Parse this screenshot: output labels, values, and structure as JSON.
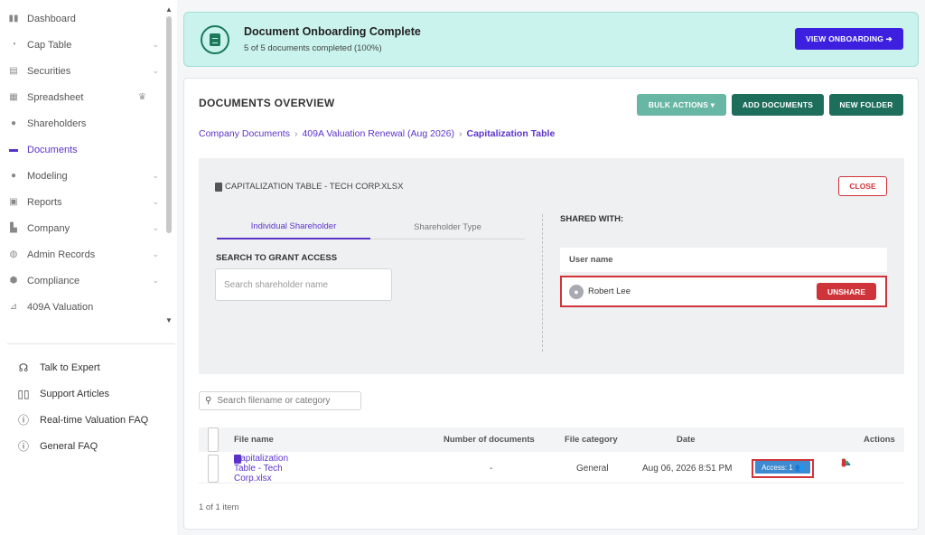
{
  "sidebar": {
    "items": [
      {
        "label": "Dashboard",
        "icon": "dashboard-icon",
        "chevron": false,
        "active": false
      },
      {
        "label": "Cap Table",
        "icon": "pie-chart-icon",
        "chevron": true,
        "active": false
      },
      {
        "label": "Securities",
        "icon": "certificate-icon",
        "chevron": true,
        "active": false
      },
      {
        "label": "Spreadsheet",
        "icon": "spreadsheet-icon",
        "chevron": false,
        "active": false
      },
      {
        "label": "Shareholders",
        "icon": "user-icon",
        "chevron": false,
        "active": false
      },
      {
        "label": "Documents",
        "icon": "folder-icon",
        "chevron": false,
        "active": true
      },
      {
        "label": "Modeling",
        "icon": "lightbulb-icon",
        "chevron": true,
        "active": false
      },
      {
        "label": "Reports",
        "icon": "report-icon",
        "chevron": true,
        "active": false
      },
      {
        "label": "Company",
        "icon": "building-icon",
        "chevron": true,
        "active": false
      },
      {
        "label": "Admin Records",
        "icon": "admin-icon",
        "chevron": true,
        "active": false
      },
      {
        "label": "Compliance",
        "icon": "shield-icon",
        "chevron": true,
        "active": false
      },
      {
        "label": "409A Valuation",
        "icon": "valuation-icon",
        "chevron": false,
        "active": false
      }
    ],
    "help": [
      {
        "label": "Talk to Expert",
        "icon": "headset-icon"
      },
      {
        "label": "Support Articles",
        "icon": "book-icon"
      },
      {
        "label": "Real-time Valuation FAQ",
        "icon": "question-icon"
      },
      {
        "label": "General FAQ",
        "icon": "question-icon"
      }
    ]
  },
  "banner": {
    "title": "Document Onboarding Complete",
    "subtitle": "5 of 5 documents completed (100%)",
    "button": "VIEW ONBOARDING ➔"
  },
  "main": {
    "title": "DOCUMENTS OVERVIEW",
    "buttons": {
      "bulk": "BULK ACTIONS ▾",
      "add": "ADD DOCUMENTS",
      "folder": "NEW FOLDER"
    },
    "breadcrumb": [
      "Company Documents",
      "409A Valuation Renewal (Aug 2026)",
      "Capitalization Table"
    ],
    "breadcrumb_sep": "›"
  },
  "share": {
    "file_heading": "CAPITALIZATION TABLE - TECH CORP.XLSX",
    "close": "CLOSE",
    "tabs": [
      "Individual Shareholder",
      "Shareholder Type"
    ],
    "search_label": "SEARCH TO GRANT ACCESS",
    "search_placeholder": "Search shareholder name",
    "shared_with": "SHARED WITH:",
    "user_header": "User name",
    "users": [
      {
        "name": "Robert Lee",
        "action": "UNSHARE"
      }
    ]
  },
  "table": {
    "search_placeholder": "Search filename or category",
    "headers": {
      "filename": "File name",
      "count": "Number of documents",
      "category": "File category",
      "date": "Date",
      "actions": "Actions"
    },
    "rows": [
      {
        "filename": "Capitalization Table - Tech Corp.xlsx",
        "count": "-",
        "category": "General",
        "date": "Aug 06, 2026 8:51 PM",
        "access": "Access: 1 👥"
      }
    ],
    "pager": "1 of 1 item"
  },
  "colors": {
    "accent": "#5b33c9",
    "banner_bg": "#c9f3ec",
    "teal_button": "#1e6e5c",
    "danger": "#d0343a"
  }
}
